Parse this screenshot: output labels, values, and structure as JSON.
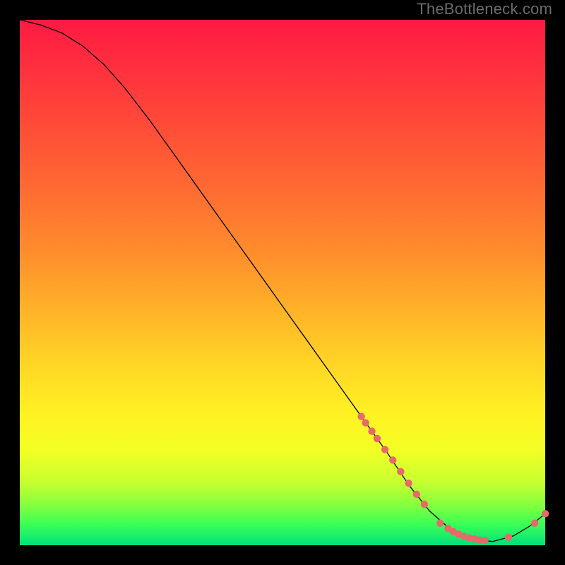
{
  "watermark": "TheBottleneck.com",
  "colors": {
    "background": "#000000",
    "watermark": "#6b6b6b",
    "curve": "#000000",
    "marker": "#e76a6a",
    "gradient_top": "#ff1a42",
    "gradient_bottom": "#00e07a"
  },
  "chart_data": {
    "type": "line",
    "title": "",
    "xlabel": "",
    "ylabel": "",
    "xlim": [
      0,
      100
    ],
    "ylim": [
      0,
      100
    ],
    "grid": false,
    "legend": false,
    "curve": [
      {
        "x": 0,
        "y": 100
      },
      {
        "x": 4,
        "y": 99
      },
      {
        "x": 8,
        "y": 97.5
      },
      {
        "x": 12,
        "y": 95
      },
      {
        "x": 16,
        "y": 91.5
      },
      {
        "x": 20,
        "y": 87
      },
      {
        "x": 25,
        "y": 80.5
      },
      {
        "x": 30,
        "y": 73.5
      },
      {
        "x": 35,
        "y": 66.5
      },
      {
        "x": 40,
        "y": 59.5
      },
      {
        "x": 45,
        "y": 52.5
      },
      {
        "x": 50,
        "y": 45.5
      },
      {
        "x": 55,
        "y": 38.5
      },
      {
        "x": 60,
        "y": 31.5
      },
      {
        "x": 65,
        "y": 24.5
      },
      {
        "x": 70,
        "y": 17.5
      },
      {
        "x": 74,
        "y": 11.5
      },
      {
        "x": 78,
        "y": 6.5
      },
      {
        "x": 82,
        "y": 3
      },
      {
        "x": 86,
        "y": 1.2
      },
      {
        "x": 90,
        "y": 0.7
      },
      {
        "x": 94,
        "y": 1.8
      },
      {
        "x": 97,
        "y": 3.6
      },
      {
        "x": 100,
        "y": 6
      }
    ],
    "markers": [
      {
        "x": 65.0,
        "y": 24.5
      },
      {
        "x": 65.8,
        "y": 23.3
      },
      {
        "x": 67.0,
        "y": 21.7
      },
      {
        "x": 68.0,
        "y": 20.3
      },
      {
        "x": 69.5,
        "y": 18.2
      },
      {
        "x": 71.0,
        "y": 16.2
      },
      {
        "x": 72.5,
        "y": 14.0
      },
      {
        "x": 74.0,
        "y": 11.8
      },
      {
        "x": 75.5,
        "y": 9.7
      },
      {
        "x": 77.0,
        "y": 7.8
      },
      {
        "x": 80.0,
        "y": 4.2
      },
      {
        "x": 81.5,
        "y": 3.2
      },
      {
        "x": 82.5,
        "y": 2.6
      },
      {
        "x": 83.5,
        "y": 2.1
      },
      {
        "x": 84.5,
        "y": 1.7
      },
      {
        "x": 85.5,
        "y": 1.4
      },
      {
        "x": 86.5,
        "y": 1.2
      },
      {
        "x": 87.5,
        "y": 1.0
      },
      {
        "x": 88.5,
        "y": 0.9
      },
      {
        "x": 93.0,
        "y": 1.5
      },
      {
        "x": 98.0,
        "y": 4.2
      },
      {
        "x": 100.0,
        "y": 6.0
      }
    ]
  }
}
